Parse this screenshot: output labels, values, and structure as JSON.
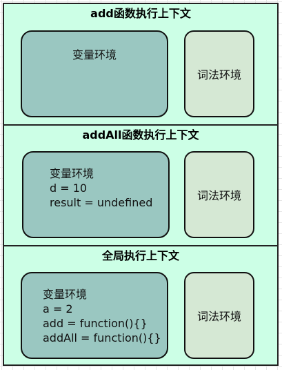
{
  "sections": [
    {
      "title": "add函数执行上下文",
      "variable_env": {
        "label": "变量环境",
        "entries": []
      },
      "lexical_env": {
        "label": "词法环境"
      }
    },
    {
      "title": "addAll函数执行上下文",
      "variable_env": {
        "label": "变量环境",
        "entries": [
          "d = 10",
          "result = undefined"
        ]
      },
      "lexical_env": {
        "label": "词法环境"
      }
    },
    {
      "title": "全局执行上下文",
      "variable_env": {
        "label": "变量环境",
        "entries": [
          "a = 2",
          "add = function(){}",
          "addAll = function(){}"
        ]
      },
      "lexical_env": {
        "label": "词法环境"
      }
    }
  ],
  "colors": {
    "section_fill": "#ccffe6",
    "variable_env_fill": "#9ac7c1",
    "lexical_env_fill": "#d5e8d4",
    "stroke": "#111111"
  }
}
